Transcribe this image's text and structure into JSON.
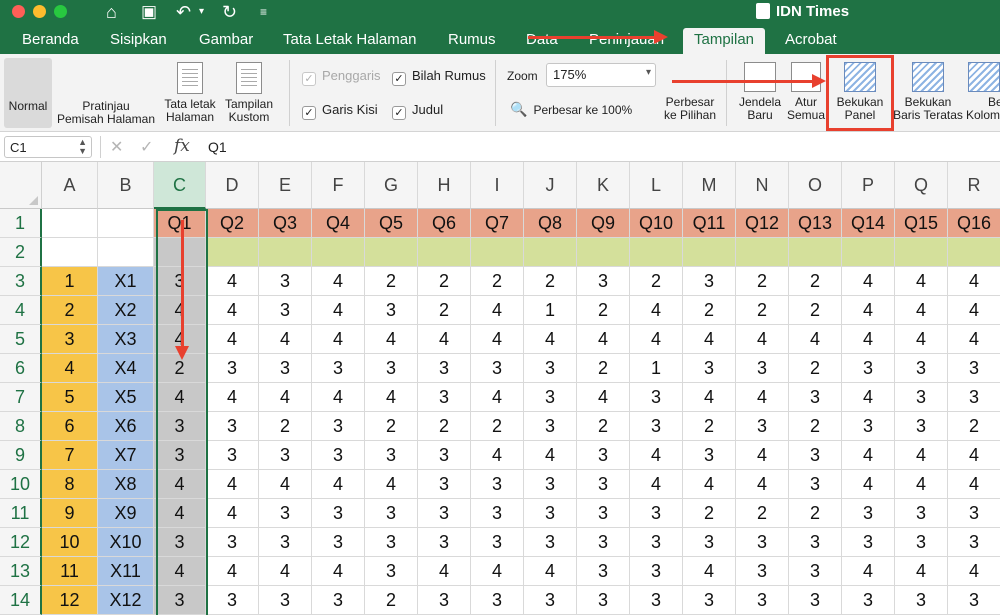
{
  "window": {
    "title": "IDN Times"
  },
  "quick_access": {
    "icons": [
      "home-icon",
      "save-icon",
      "undo-icon",
      "redo-icon",
      "customize-icon"
    ]
  },
  "tabs": [
    {
      "label": "Beranda"
    },
    {
      "label": "Sisipkan"
    },
    {
      "label": "Gambar"
    },
    {
      "label": "Tata Letak Halaman"
    },
    {
      "label": "Rumus"
    },
    {
      "label": "Data"
    },
    {
      "label": "Peninjauan"
    },
    {
      "label": "Tampilan",
      "active": true
    },
    {
      "label": "Acrobat"
    }
  ],
  "ribbon": {
    "normal": "Normal",
    "page_break_1": "Pratinjau",
    "page_break_2": "Pemisah Halaman",
    "page_layout_1": "Tata letak",
    "page_layout_2": "Halaman",
    "custom_1": "Tampilan",
    "custom_2": "Kustom",
    "ruler": "Penggaris",
    "formula_bar": "Bilah Rumus",
    "gridlines": "Garis Kisi",
    "headings": "Judul",
    "zoom_label": "Zoom",
    "zoom_value": "175%",
    "zoom_100": "Perbesar ke 100%",
    "zoom_sel_1": "Perbesar",
    "zoom_sel_2": "ke Pilihan",
    "new_window_1": "Jendela",
    "new_window_2": "Baru",
    "arrange_1": "Atur",
    "arrange_2": "Semua",
    "freeze_1": "Bekukan",
    "freeze_2": "Panel",
    "freeze_top_1": "Bekukan",
    "freeze_top_2": "Baris Teratas",
    "freeze_col_1": "Be",
    "freeze_col_2": "Kolom"
  },
  "formula_bar": {
    "name_box": "C1",
    "content": "Q1",
    "fx": "fx"
  },
  "grid": {
    "columns": [
      "A",
      "B",
      "C",
      "D",
      "E",
      "F",
      "G",
      "H",
      "I",
      "J",
      "K",
      "L",
      "M",
      "N",
      "O",
      "P",
      "Q",
      "R"
    ],
    "rows": [
      "1",
      "2",
      "3",
      "4",
      "5",
      "6",
      "7",
      "8",
      "9",
      "10",
      "11",
      "12",
      "13",
      "14"
    ],
    "headers": [
      "Q1",
      "Q2",
      "Q3",
      "Q4",
      "Q5",
      "Q6",
      "Q7",
      "Q8",
      "Q9",
      "Q10",
      "Q11",
      "Q12",
      "Q13",
      "Q14",
      "Q15",
      "Q16"
    ],
    "data": [
      [
        "1",
        "X1",
        "3",
        "4",
        "3",
        "4",
        "2",
        "2",
        "2",
        "2",
        "3",
        "2",
        "3",
        "2",
        "2",
        "4",
        "4",
        "4"
      ],
      [
        "2",
        "X2",
        "4",
        "4",
        "3",
        "4",
        "3",
        "2",
        "4",
        "1",
        "2",
        "4",
        "2",
        "2",
        "2",
        "4",
        "4",
        "4"
      ],
      [
        "3",
        "X3",
        "4",
        "4",
        "4",
        "4",
        "4",
        "4",
        "4",
        "4",
        "4",
        "4",
        "4",
        "4",
        "4",
        "4",
        "4",
        "4"
      ],
      [
        "4",
        "X4",
        "2",
        "3",
        "3",
        "3",
        "3",
        "3",
        "3",
        "3",
        "2",
        "1",
        "3",
        "3",
        "2",
        "3",
        "3",
        "3"
      ],
      [
        "5",
        "X5",
        "4",
        "4",
        "4",
        "4",
        "4",
        "3",
        "4",
        "3",
        "4",
        "3",
        "4",
        "4",
        "3",
        "4",
        "3",
        "3"
      ],
      [
        "6",
        "X6",
        "3",
        "3",
        "2",
        "3",
        "2",
        "2",
        "2",
        "3",
        "2",
        "3",
        "2",
        "3",
        "2",
        "3",
        "3",
        "2"
      ],
      [
        "7",
        "X7",
        "3",
        "3",
        "3",
        "3",
        "3",
        "3",
        "4",
        "4",
        "3",
        "4",
        "3",
        "4",
        "3",
        "4",
        "4",
        "4"
      ],
      [
        "8",
        "X8",
        "4",
        "4",
        "4",
        "4",
        "4",
        "3",
        "3",
        "3",
        "3",
        "4",
        "4",
        "4",
        "3",
        "4",
        "4",
        "4"
      ],
      [
        "9",
        "X9",
        "4",
        "4",
        "3",
        "3",
        "3",
        "3",
        "3",
        "3",
        "3",
        "3",
        "2",
        "2",
        "2",
        "3",
        "3",
        "3"
      ],
      [
        "10",
        "X10",
        "3",
        "3",
        "3",
        "3",
        "3",
        "3",
        "3",
        "3",
        "3",
        "3",
        "3",
        "3",
        "3",
        "3",
        "3",
        "3"
      ],
      [
        "11",
        "X11",
        "4",
        "4",
        "4",
        "4",
        "3",
        "4",
        "4",
        "4",
        "3",
        "3",
        "4",
        "3",
        "3",
        "4",
        "4",
        "4"
      ],
      [
        "12",
        "X12",
        "3",
        "3",
        "3",
        "3",
        "2",
        "3",
        "3",
        "3",
        "3",
        "3",
        "3",
        "3",
        "3",
        "3",
        "3",
        "3"
      ]
    ]
  },
  "colors": {
    "accent": "#1f7244",
    "header_row": "#e8a38a",
    "row2": "#d4e09b",
    "col_a": "#f7c548",
    "col_b": "#a9c4e8",
    "col_c": "#c8c8c8",
    "arrow": "#e8402e"
  }
}
